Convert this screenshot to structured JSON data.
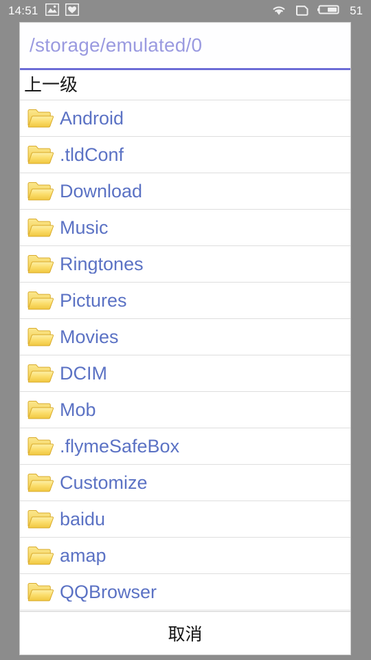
{
  "statusbar": {
    "clock": "14:51",
    "battery_level": "51",
    "left_icons": [
      "image-icon",
      "heart-badge-icon"
    ],
    "right_icons": [
      "wifi-icon",
      "sim-card-icon",
      "battery-icon"
    ]
  },
  "dialog": {
    "path_field": {
      "value": "/storage/emulated/0",
      "placeholder": "/storage/emulated/0",
      "underline_color": "#6b6bd6",
      "text_color": "#9a9ae0"
    },
    "up_row": {
      "label": "上一级"
    },
    "folders": [
      {
        "name": "Android",
        "icon": "folder-icon"
      },
      {
        "name": ".tldConf",
        "icon": "folder-icon"
      },
      {
        "name": "Download",
        "icon": "folder-icon"
      },
      {
        "name": "Music",
        "icon": "folder-icon"
      },
      {
        "name": "Ringtones",
        "icon": "folder-icon"
      },
      {
        "name": "Pictures",
        "icon": "folder-icon"
      },
      {
        "name": "Movies",
        "icon": "folder-icon"
      },
      {
        "name": "DCIM",
        "icon": "folder-icon"
      },
      {
        "name": "Mob",
        "icon": "folder-icon"
      },
      {
        "name": ".flymeSafeBox",
        "icon": "folder-icon"
      },
      {
        "name": "Customize",
        "icon": "folder-icon"
      },
      {
        "name": "baidu",
        "icon": "folder-icon"
      },
      {
        "name": "amap",
        "icon": "folder-icon"
      },
      {
        "name": "QQBrowser",
        "icon": "folder-icon"
      }
    ],
    "footer": {
      "cancel_label": "取消"
    }
  },
  "colors": {
    "scrim": "#8c8c8c",
    "dialog_bg": "#ffffff",
    "folder_label": "#5b72c4",
    "accent": "#6b6bd6",
    "divider": "#dedede"
  }
}
